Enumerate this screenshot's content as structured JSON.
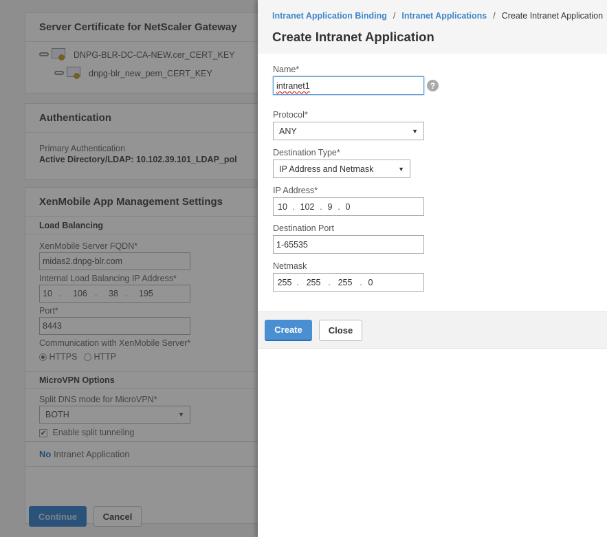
{
  "background": {
    "cert_section": {
      "title": "Server Certificate for NetScaler Gateway",
      "certs": [
        "DNPG-BLR-DC-CA-NEW.cer_CERT_KEY",
        "dnpg-blr_new_pem_CERT_KEY"
      ]
    },
    "auth_section": {
      "title": "Authentication",
      "primary_label": "Primary Authentication",
      "primary_value": "Active Directory/LDAP: 10.102.39.101_LDAP_pol"
    },
    "xenmobile_section": {
      "title": "XenMobile App Management Settings",
      "load_balancing": "Load Balancing",
      "fqdn_label": "XenMobile Server FQDN*",
      "fqdn_value": "midas2.dnpg-blr.com",
      "lb_ip_label": "Internal Load Balancing IP Address*",
      "lb_ip": [
        "10",
        "106",
        "38",
        "195"
      ],
      "port_label": "Port*",
      "port_value": "8443",
      "comm_label": "Communication with XenMobile Server*",
      "comm_options": [
        "HTTPS",
        "HTTP"
      ],
      "comm_selected": "HTTPS",
      "microvpn": "MicroVPN Options",
      "split_dns_label": "Split DNS mode for MicroVPN*",
      "split_dns_value": "BOTH",
      "split_tunnel_label": "Enable split tunneling",
      "split_tunnel_checked": true,
      "intranet_no": "No",
      "intranet_label": "Intranet Application"
    },
    "buttons": {
      "continue": "Continue",
      "cancel": "Cancel"
    }
  },
  "panel": {
    "breadcrumb": [
      "Intranet Application Binding",
      "Intranet Applications",
      "Create Intranet Application"
    ],
    "title": "Create Intranet Application",
    "name_label": "Name*",
    "name_value": "intranet1",
    "help_glyph": "?",
    "protocol_label": "Protocol*",
    "protocol_value": "ANY",
    "dest_type_label": "Destination Type*",
    "dest_type_value": "IP Address and Netmask",
    "ip_label": "IP Address*",
    "ip": [
      "10",
      "102",
      "9",
      "0"
    ],
    "port_label": "Destination Port",
    "port_value": "1-65535",
    "netmask_label": "Netmask",
    "netmask": [
      "255",
      "255",
      "255",
      "0"
    ],
    "create": "Create",
    "close": "Close"
  },
  "colors": {
    "accent": "#4a8fd1",
    "link": "#3f87c9"
  }
}
